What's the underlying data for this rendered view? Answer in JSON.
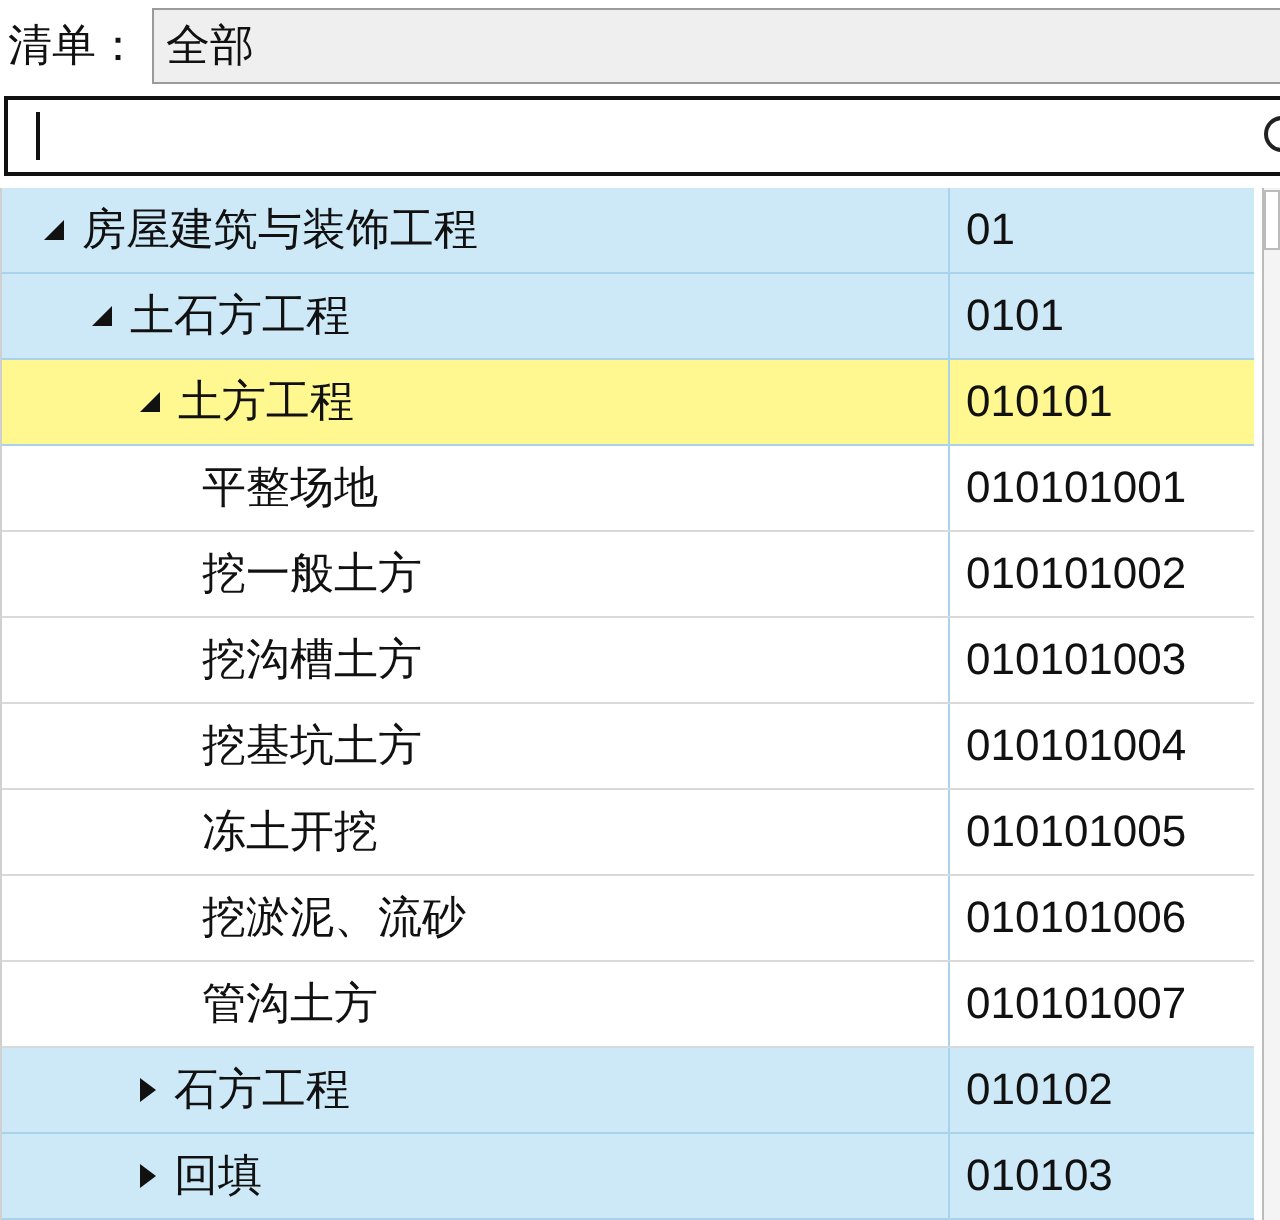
{
  "filter": {
    "label": "清单：",
    "value": "全部"
  },
  "tree": [
    {
      "kind": "branch",
      "name": "房屋建筑与装饰工程",
      "code": "01",
      "expanded": true,
      "selected": false,
      "children": [
        {
          "kind": "branch",
          "name": "土石方工程",
          "code": "0101",
          "expanded": true,
          "selected": false,
          "children": [
            {
              "kind": "branch",
              "name": "土方工程",
              "code": "010101",
              "expanded": true,
              "selected": true,
              "children": [
                {
                  "kind": "leaf",
                  "name": "平整场地",
                  "code": "010101001",
                  "selected": false
                },
                {
                  "kind": "leaf",
                  "name": "挖一般土方",
                  "code": "010101002",
                  "selected": false
                },
                {
                  "kind": "leaf",
                  "name": "挖沟槽土方",
                  "code": "010101003",
                  "selected": false
                },
                {
                  "kind": "leaf",
                  "name": "挖基坑土方",
                  "code": "010101004",
                  "selected": false
                },
                {
                  "kind": "leaf",
                  "name": "冻土开挖",
                  "code": "010101005",
                  "selected": false
                },
                {
                  "kind": "leaf",
                  "name": "挖淤泥、流砂",
                  "code": "010101006",
                  "selected": false
                },
                {
                  "kind": "leaf",
                  "name": "管沟土方",
                  "code": "010101007",
                  "selected": false
                }
              ]
            },
            {
              "kind": "branch",
              "name": "石方工程",
              "code": "010102",
              "expanded": false,
              "selected": false
            },
            {
              "kind": "branch",
              "name": "回填",
              "code": "010103",
              "expanded": false,
              "selected": false
            }
          ]
        }
      ]
    }
  ]
}
